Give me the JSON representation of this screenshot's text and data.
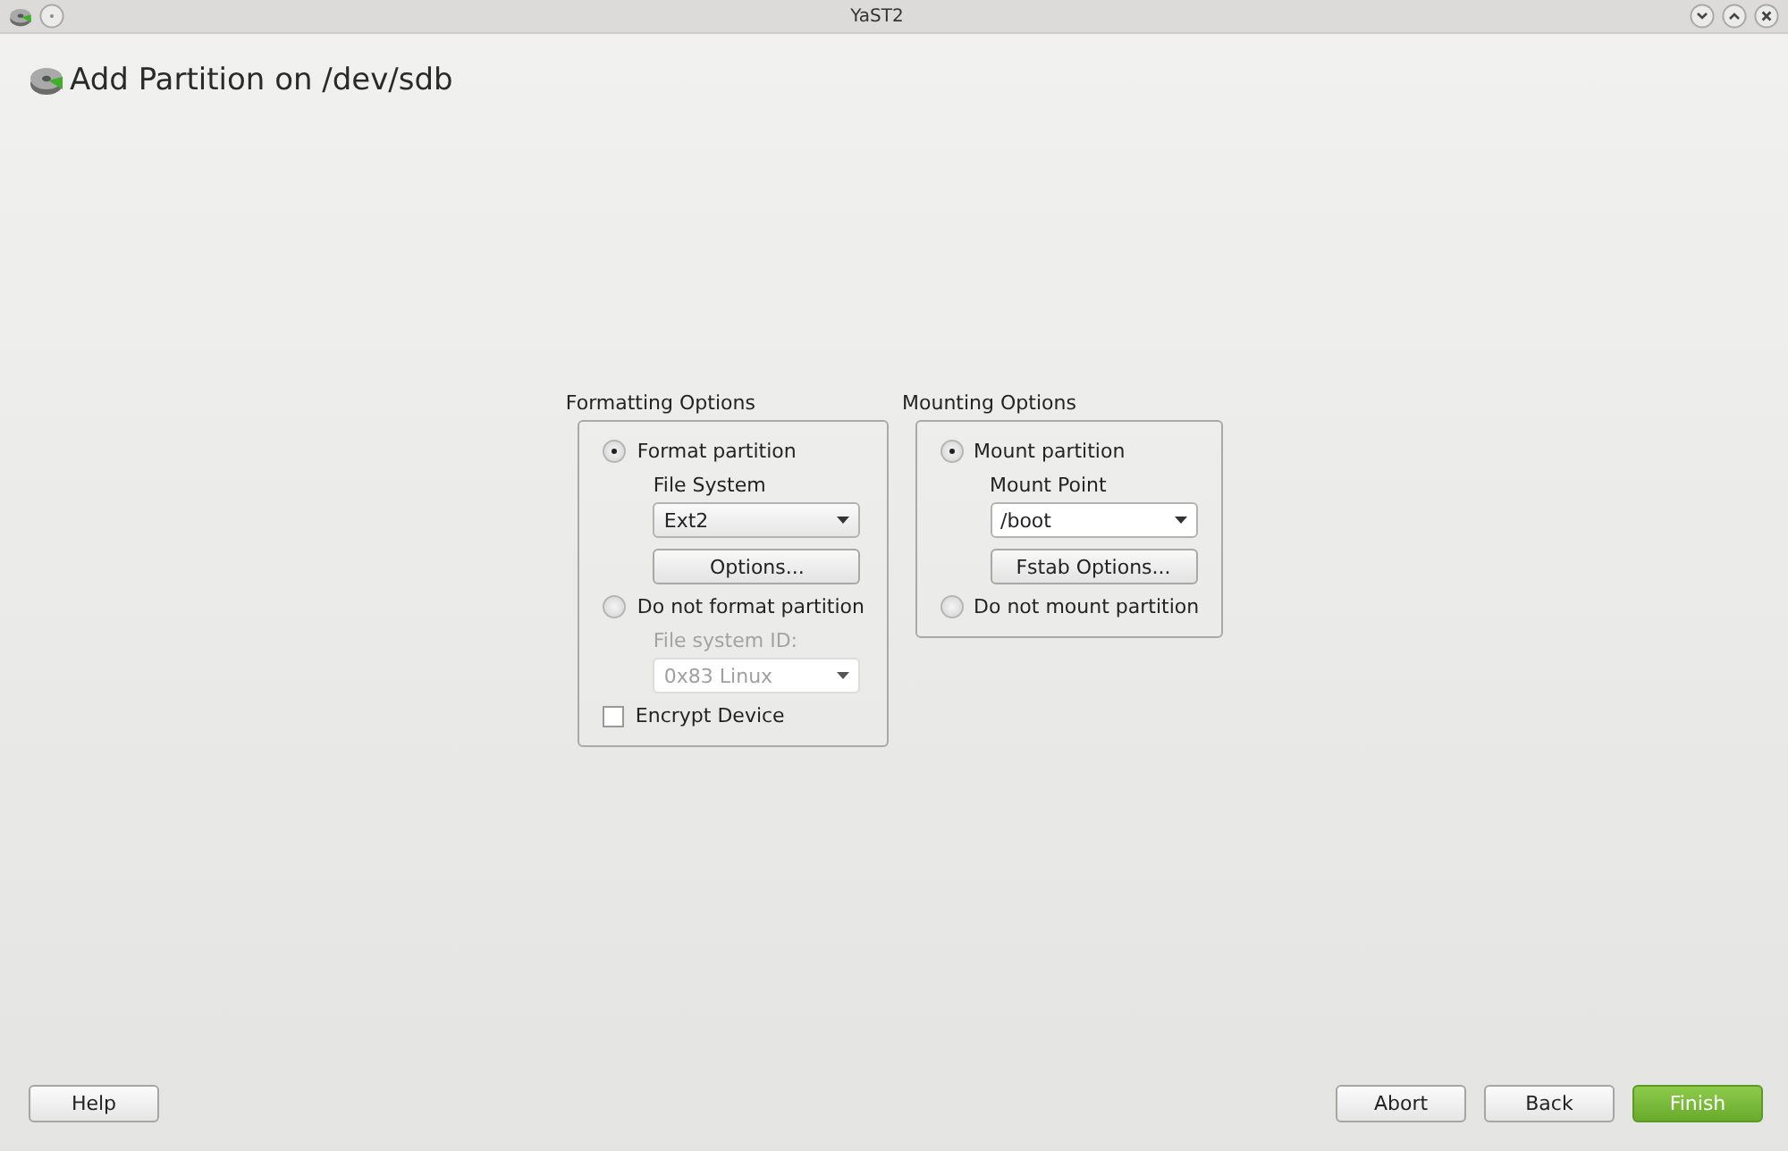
{
  "window": {
    "title": "YaST2"
  },
  "heading": {
    "text": "Add Partition on /dev/sdb"
  },
  "groups": [
    {
      "title": "Formatting Options",
      "items": [
        {
          "kind": "radio",
          "label": "Format partition",
          "selected": true
        },
        {
          "kind": "label",
          "text": "File System",
          "disabled": false
        },
        {
          "kind": "combo",
          "value": "Ext2",
          "disabled": false
        },
        {
          "kind": "button",
          "label": "Options..."
        },
        {
          "kind": "radio",
          "label": "Do not format partition",
          "selected": false
        },
        {
          "kind": "label",
          "text": "File system ID:",
          "disabled": true
        },
        {
          "kind": "combo",
          "value": "0x83 Linux",
          "disabled": true
        },
        {
          "kind": "checkbox",
          "label": "Encrypt Device",
          "checked": false
        }
      ]
    },
    {
      "title": "Mounting Options",
      "items": [
        {
          "kind": "radio",
          "label": "Mount partition",
          "selected": true
        },
        {
          "kind": "label",
          "text": "Mount Point",
          "disabled": false
        },
        {
          "kind": "combo",
          "value": "/boot",
          "disabled": false,
          "editable": true
        },
        {
          "kind": "button",
          "label": "Fstab Options..."
        },
        {
          "kind": "radio",
          "label": "Do not mount partition",
          "selected": false
        }
      ]
    }
  ],
  "footer": {
    "left": [
      {
        "label": "Help",
        "primary": false
      }
    ],
    "right": [
      {
        "label": "Abort",
        "primary": false
      },
      {
        "label": "Back",
        "primary": false
      },
      {
        "label": "Finish",
        "primary": true
      }
    ]
  }
}
